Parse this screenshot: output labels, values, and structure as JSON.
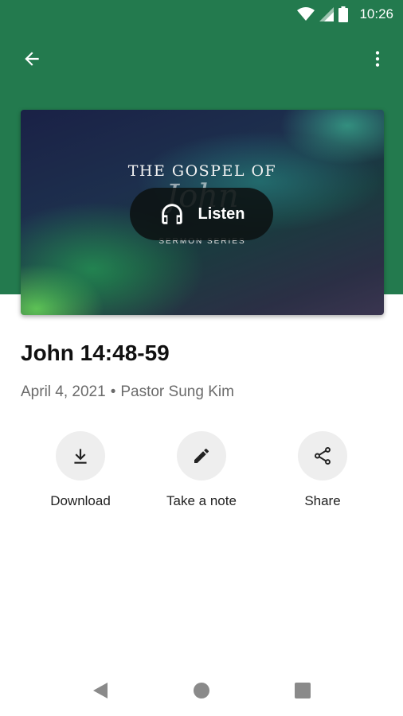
{
  "status_bar": {
    "time": "10:26"
  },
  "artwork": {
    "title": "THE GOSPEL OF",
    "script_text": "John",
    "subtitle": "SERMON SERIES"
  },
  "listen_button": {
    "label": "Listen"
  },
  "sermon": {
    "title": "John 14:48-59",
    "date": "April 4, 2021",
    "separator": "•",
    "speaker": "Pastor Sung Kim"
  },
  "actions": {
    "download": "Download",
    "note": "Take a note",
    "share": "Share"
  },
  "colors": {
    "header_green": "#237a4e",
    "action_circle": "#eeeeee",
    "meta_text": "#6b6b6b"
  },
  "icons": [
    "wifi-icon",
    "signal-icon",
    "battery-icon",
    "back-arrow-icon",
    "more-vert-icon",
    "headphones-icon",
    "download-icon",
    "edit-icon",
    "share-icon",
    "nav-back-icon",
    "nav-home-icon",
    "nav-recents-icon"
  ]
}
